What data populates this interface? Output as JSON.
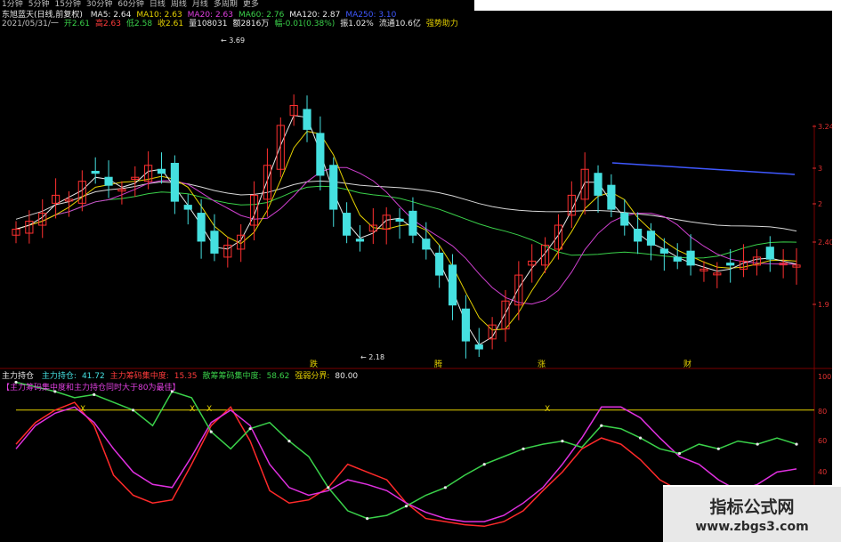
{
  "periods": [
    "1分钟",
    "5分钟",
    "15分钟",
    "30分钟",
    "60分钟",
    "日线",
    "周线",
    "月线",
    "多周期",
    "更多"
  ],
  "header": {
    "title": "东旭蓝天(日线,前复权)",
    "ma": [
      {
        "label": "MA5",
        "value": "2.64",
        "color": "#e8e8e8"
      },
      {
        "label": "MA10",
        "value": "2.63",
        "color": "#e6d200"
      },
      {
        "label": "MA20",
        "value": "2.63",
        "color": "#e040e0"
      },
      {
        "label": "MA60",
        "value": "2.76",
        "color": "#3ad14a"
      },
      {
        "label": "MA120",
        "value": "2.87",
        "color": "#e8e8e8"
      },
      {
        "label": "MA250",
        "value": "3.10",
        "color": "#3f58ff"
      }
    ],
    "quote_row1": [
      {
        "text": "2021/05/31/一",
        "color": "#bfbfbf"
      },
      {
        "text": "开2.61",
        "color": "#3ad14a"
      },
      {
        "text": "高2.63",
        "color": "#ff3b3b"
      },
      {
        "text": "低2.58",
        "color": "#3ad14a"
      },
      {
        "text": "收2.61",
        "color": "#e6d200"
      },
      {
        "text": "量108031",
        "color": "#e8e8e8"
      },
      {
        "text": "额2816万",
        "color": "#e8e8e8"
      },
      {
        "text": "幅-0.01(0.38%)",
        "color": "#3ad14a"
      },
      {
        "text": "振1.02%",
        "color": "#e8e8e8"
      },
      {
        "text": "流通10.6亿",
        "color": "#e8e8e8"
      },
      {
        "text": "强势助力",
        "color": "#e6d200"
      }
    ]
  },
  "indicator": {
    "name": "主力持仓",
    "items": [
      {
        "text": "主力持仓:",
        "color": "#45e0e0"
      },
      {
        "text": "41.72",
        "color": "#45e0e0"
      },
      {
        "text": "主力筹码集中度:",
        "color": "#ff3b3b"
      },
      {
        "text": "15.35",
        "color": "#ff3b3b"
      },
      {
        "text": "散筹筹码集中度:",
        "color": "#3ad14a"
      },
      {
        "text": "58.62",
        "color": "#3ad14a"
      },
      {
        "text": "强弱分界:",
        "color": "#e6d200"
      },
      {
        "text": "80.00",
        "color": "#e8e8e8"
      }
    ],
    "note": "【主力筹码集中度和主力持仓同时大于80为最佳】"
  },
  "price_axis": [
    {
      "label": "3.24",
      "y": 145
    },
    {
      "label": "3",
      "y": 192
    },
    {
      "label": "2",
      "y": 232
    },
    {
      "label": "2.40",
      "y": 275
    },
    {
      "label": "1.9",
      "y": 345
    }
  ],
  "indicator_axis": [
    {
      "label": "100",
      "y": 426
    },
    {
      "label": "80",
      "y": 465
    },
    {
      "label": "60",
      "y": 498
    },
    {
      "label": "40",
      "y": 533
    }
  ],
  "annotations": [
    {
      "text": "3.69",
      "x": 248,
      "y": 48
    },
    {
      "text": "2.18",
      "x": 405,
      "y": 404
    }
  ],
  "signals": [
    {
      "text": "跌",
      "x": 348
    },
    {
      "text": "腾",
      "x": 488
    },
    {
      "text": "涨",
      "x": 604
    },
    {
      "text": "财",
      "x": 768
    }
  ],
  "cross_markers": [
    {
      "text": "X",
      "x": 90,
      "y": 462
    },
    {
      "text": "X",
      "x": 213,
      "y": 462
    },
    {
      "text": "X",
      "x": 232,
      "y": 462
    },
    {
      "text": "X",
      "x": 612,
      "y": 462
    }
  ],
  "watermark": {
    "line1": "指标公式网",
    "line2": "www.zbgs3.com"
  },
  "colors": {
    "up": "#ff3030",
    "down": "#45e0e0",
    "ma5": "#e8e8e8",
    "ma10": "#e6d200",
    "ma20": "#d040d0",
    "ma60": "#3ad14a",
    "ma120": "#d8d8d8",
    "ma250": "#3f58ff",
    "main_concentration": "#ff2a2a",
    "main_position": "#e030e0",
    "retail": "#3ad14a",
    "threshold": "#e6d200"
  },
  "chart_data": {
    "type": "line",
    "title": "",
    "indicator_threshold": 80,
    "price_close": [
      2.78,
      2.82,
      2.86,
      2.95,
      2.93,
      3.02,
      3.06,
      3.0,
      2.98,
      3.04,
      3.1,
      3.06,
      2.92,
      2.88,
      2.72,
      2.66,
      2.7,
      2.75,
      2.95,
      3.1,
      3.3,
      3.4,
      3.28,
      3.05,
      2.88,
      2.75,
      2.72,
      2.8,
      2.85,
      2.82,
      2.75,
      2.68,
      2.55,
      2.4,
      2.22,
      2.18,
      2.3,
      2.42,
      2.55,
      2.62,
      2.7,
      2.8,
      2.95,
      3.08,
      2.95,
      2.88,
      2.8,
      2.72,
      2.7,
      2.66,
      2.62,
      2.6,
      2.58,
      2.56,
      2.6,
      2.62,
      2.64,
      2.63,
      2.61,
      2.6
    ],
    "series": [
      {
        "name": "主力筹码集中度",
        "values": [
          58,
          72,
          80,
          85,
          70,
          38,
          25,
          20,
          22,
          45,
          70,
          82,
          60,
          28,
          20,
          22,
          30,
          45,
          40,
          35,
          20,
          10,
          8,
          6,
          5,
          8,
          15,
          28,
          40,
          55,
          62,
          58,
          48,
          35,
          28,
          30,
          20,
          12,
          8,
          5,
          4
        ]
      },
      {
        "name": "主力持仓",
        "values": [
          55,
          70,
          78,
          82,
          72,
          55,
          40,
          32,
          30,
          50,
          72,
          80,
          70,
          45,
          30,
          25,
          28,
          35,
          32,
          28,
          20,
          14,
          10,
          8,
          8,
          12,
          20,
          30,
          45,
          62,
          82,
          82,
          75,
          62,
          50,
          45,
          35,
          28,
          32,
          40,
          42
        ]
      },
      {
        "name": "散筹筹码集中度",
        "values": [
          98,
          95,
          92,
          88,
          90,
          85,
          80,
          70,
          92,
          88,
          66,
          55,
          68,
          72,
          60,
          50,
          30,
          15,
          10,
          12,
          18,
          25,
          30,
          38,
          45,
          50,
          55,
          58,
          60,
          56,
          70,
          68,
          62,
          55,
          52,
          58,
          55,
          60,
          58,
          62,
          58
        ]
      }
    ]
  }
}
